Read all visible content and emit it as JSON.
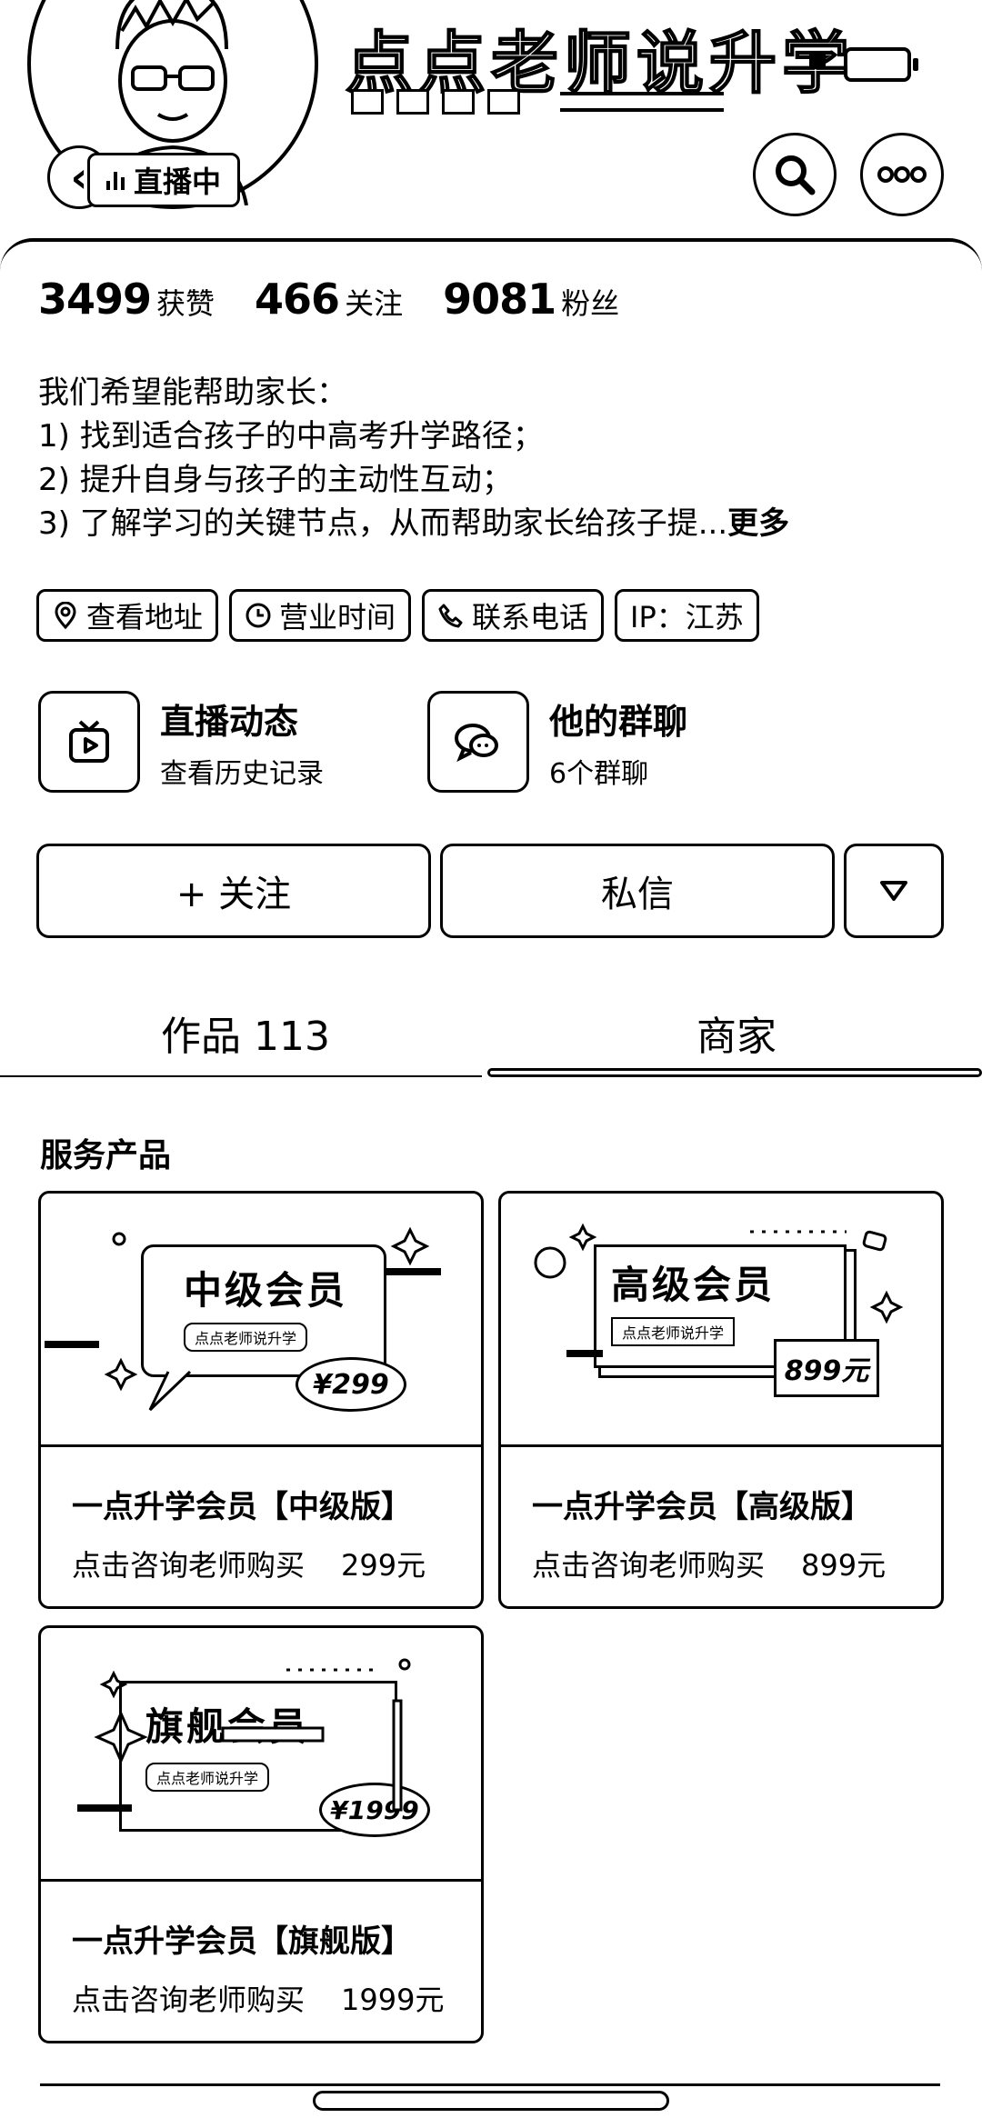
{
  "header": {
    "banner_title": "点点老师说升学",
    "live_label": "直播中",
    "icons": {
      "back": "chevron-left-icon",
      "search": "search-icon",
      "more": "more-dots-icon"
    }
  },
  "stats": [
    {
      "value": "3499",
      "label": "获赞"
    },
    {
      "value": "466",
      "label": "关注"
    },
    {
      "value": "9081",
      "label": "粉丝"
    }
  ],
  "bio": {
    "lines": [
      "我们希望能帮助家长：",
      "1) 找到适合孩子的中高考升学路径；",
      "2) 提升自身与孩子的主动性互动；",
      "3) 了解学习的关键节点，从而帮助家长给孩子提..."
    ],
    "more_label": "更多"
  },
  "chips": [
    {
      "label": "查看地址",
      "icon": "location-pin-icon"
    },
    {
      "label": "营业时间",
      "icon": "clock-icon"
    },
    {
      "label": "联系电话",
      "icon": "phone-icon"
    },
    {
      "label": "IP：江苏",
      "icon": ""
    }
  ],
  "features": [
    {
      "title": "直播动态",
      "subtitle": "查看历史记录",
      "icon": "tv-play-icon"
    },
    {
      "title": "他的群聊",
      "subtitle": "6个群聊",
      "icon": "chat-bubbles-icon"
    }
  ],
  "actions": {
    "follow_label": "+ 关注",
    "message_label": "私信",
    "dropdown_icon": "triangle-down-icon"
  },
  "tabs": [
    {
      "label": "作品 113",
      "active": false
    },
    {
      "label": "商家",
      "active": true
    }
  ],
  "section_title": "服务产品",
  "products": [
    {
      "name": "一点升学会员【中级版】",
      "cta": "点击咨询老师购买",
      "price": "299元",
      "promo_title": "中级会员",
      "promo_sub": "点点老师说升学",
      "promo_price": "¥299"
    },
    {
      "name": "一点升学会员【高级版】",
      "cta": "点击咨询老师购买",
      "price": "899元",
      "promo_title": "高级会员",
      "promo_sub": "点点老师说升学",
      "promo_price": "899元"
    },
    {
      "name": "一点升学会员【旗舰版】",
      "cta": "点击咨询老师购买",
      "price": "1999元",
      "promo_title": "旗舰会员",
      "promo_sub": "点点老师说升学",
      "promo_price": "¥1999"
    }
  ]
}
